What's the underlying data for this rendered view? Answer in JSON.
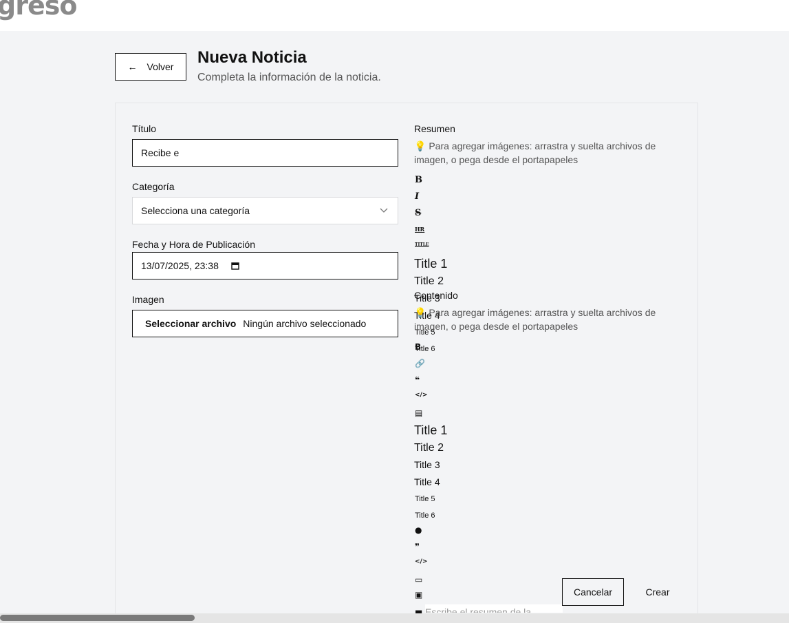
{
  "header": {
    "logo_text": "greso"
  },
  "nav": {
    "back_arrow": "←",
    "back_label": "Volver"
  },
  "page": {
    "title": "Nueva Noticia",
    "subtitle": "Completa la información de la noticia."
  },
  "form": {
    "title_label": "Título",
    "title_value": "Recibe e",
    "category_label": "Categoría",
    "category_selected": "Selecciona una categoría",
    "date_label": "Fecha y Hora de Publicación",
    "date_value": "13/07/2025, 23:38",
    "image_label": "Imagen",
    "file_button": "Seleccionar archivo",
    "file_status": "Ningún archivo seleccionado"
  },
  "summary": {
    "label": "Resumen",
    "hint": "💡 Para agregar imágenes: arrastra y suelta archivos de imagen, o pega desde el portapapeles",
    "toolbar": [
      "B",
      "I",
      "S",
      "HR",
      "TITLE"
    ],
    "headings": [
      "Title 1",
      "Title 2",
      "Title 3",
      "Title 4",
      "Title 5",
      "Title 6"
    ],
    "placeholder": "Escribe el resumen de la"
  },
  "content": {
    "label": "Contenido",
    "hint": "💡 Para agregar imágenes: arrastra y suelta archivos de imagen, o pega desde el portapapeles",
    "toolbar_top": [
      "B",
      "🔗",
      "❝",
      "</>",
      "▤"
    ],
    "headings": [
      "Title 1",
      "Title 2",
      "Title 3",
      "Title 4",
      "Title 5",
      "Title 6"
    ],
    "toolbar_bottom": [
      "●",
      "❞",
      "</>",
      "▭",
      "▣",
      "▬"
    ]
  },
  "actions": {
    "cancel": "Cancelar",
    "create": "Crear"
  }
}
